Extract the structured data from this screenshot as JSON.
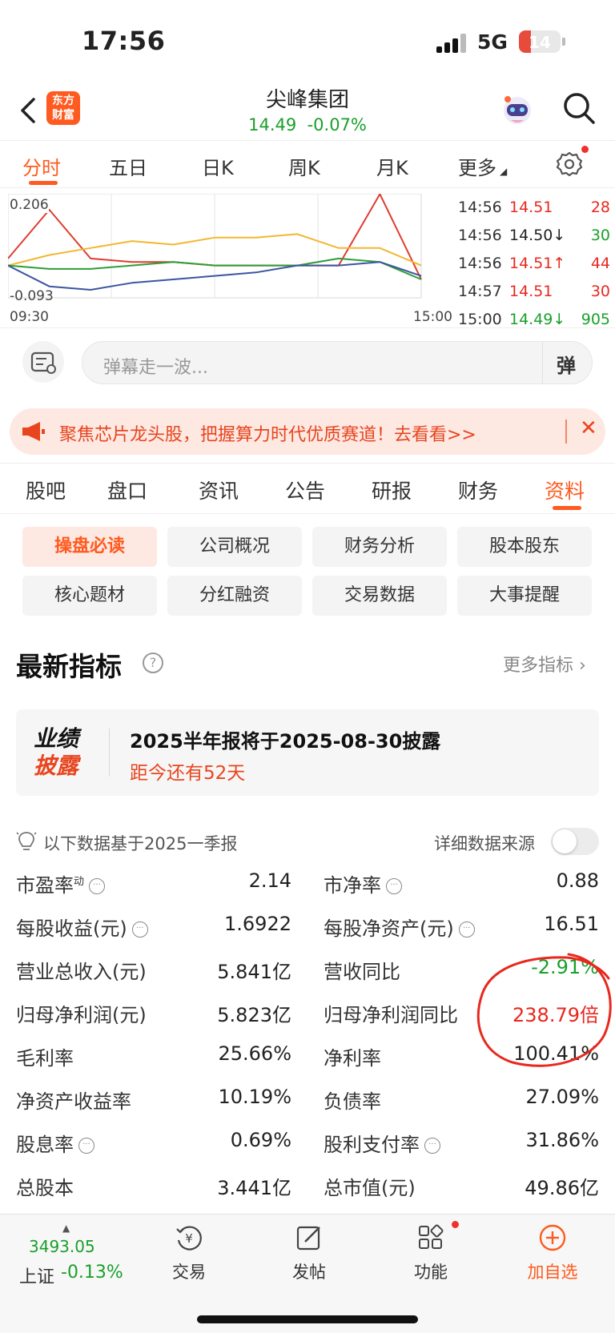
{
  "status_bar": {
    "time": "17:56",
    "network": "5G",
    "battery": "14"
  },
  "header": {
    "logo_line1": "东方",
    "logo_line2": "财富",
    "stock_name": "尖峰集团",
    "price": "14.49",
    "change": "-0.07%",
    "quote_color": "#19a02a"
  },
  "chart_tabs": [
    "分时",
    "五日",
    "日K",
    "周K",
    "月K",
    "更多"
  ],
  "chart": {
    "y_top": "0.206",
    "y_bottom": "-0.093",
    "x_start": "09:30",
    "x_end": "15:00"
  },
  "chart_data": {
    "type": "line",
    "x": [
      "09:30",
      "10:00",
      "10:30",
      "11:00",
      "11:30",
      "13:00",
      "13:30",
      "14:00",
      "14:30",
      "14:50",
      "15:00"
    ],
    "ylim": [
      -0.093,
      0.206
    ],
    "series": [
      {
        "color": "#e03b2f",
        "values": [
          0.02,
          0.16,
          0.02,
          0.01,
          0.01,
          0.0,
          0.0,
          0.0,
          0.0,
          0.205,
          -0.04
        ]
      },
      {
        "color": "#f2b730",
        "values": [
          0.0,
          0.03,
          0.05,
          0.07,
          0.06,
          0.08,
          0.08,
          0.09,
          0.05,
          0.05,
          0.0
        ]
      },
      {
        "color": "#2e9e37",
        "values": [
          0.0,
          -0.01,
          -0.01,
          0.0,
          0.01,
          0.0,
          0.0,
          0.0,
          0.02,
          0.01,
          -0.04
        ]
      },
      {
        "color": "#3b55a0",
        "values": [
          0.0,
          -0.06,
          -0.07,
          -0.05,
          -0.04,
          -0.03,
          -0.02,
          0.0,
          0.0,
          0.01,
          -0.03
        ]
      }
    ]
  },
  "ticks": [
    {
      "time": "14:56",
      "price": "14.51",
      "dir": "",
      "vol": "28",
      "pcolor": "#e8281e",
      "vcolor": "#e8281e"
    },
    {
      "time": "14:56",
      "price": "14.50",
      "dir": "↓",
      "vol": "30",
      "pcolor": "#222222",
      "vcolor": "#19a02a"
    },
    {
      "time": "14:56",
      "price": "14.51",
      "dir": "↑",
      "vol": "44",
      "pcolor": "#e8281e",
      "vcolor": "#e8281e"
    },
    {
      "time": "14:57",
      "price": "14.51",
      "dir": "",
      "vol": "30",
      "pcolor": "#e8281e",
      "vcolor": "#e8281e"
    },
    {
      "time": "15:00",
      "price": "14.49",
      "dir": "↓",
      "vol": "905",
      "pcolor": "#19a02a",
      "vcolor": "#19a02a"
    }
  ],
  "danmu": {
    "placeholder": "弹幕走一波...",
    "button": "弹"
  },
  "banner": {
    "text": "聚焦芯片龙头股，把握算力时代优质赛道！去看看>>",
    "close": "✕"
  },
  "main_tabs": [
    "股吧",
    "盘口",
    "资讯",
    "公告",
    "研报",
    "财务",
    "资料"
  ],
  "sub_tabs": [
    "操盘必读",
    "公司概况",
    "财务分析",
    "股本股东",
    "核心题材",
    "分红融资",
    "交易数据",
    "大事提醒"
  ],
  "section": {
    "title": "最新指标",
    "help": "?",
    "more": "更多指标 ›"
  },
  "disclosure": {
    "badge_top": "业绩",
    "badge_bottom": "披露",
    "line1": "2025半年报将于2025-08-30披露",
    "line2": "距今还有52天"
  },
  "basis": {
    "text": "以下数据基于2025一季报",
    "source_label": "详细数据来源"
  },
  "metrics": [
    {
      "l_label": "市盈率",
      "l_sup": "动",
      "l_info": true,
      "l_value": "2.14",
      "r_label": "市净率",
      "r_info": true,
      "r_value": "0.88",
      "r_color": ""
    },
    {
      "l_label": "每股收益(元)",
      "l_sup": "",
      "l_info": true,
      "l_value": "1.6922",
      "r_label": "每股净资产(元)",
      "r_info": true,
      "r_value": "16.51",
      "r_color": ""
    },
    {
      "l_label": "营业总收入(元)",
      "l_sup": "",
      "l_info": false,
      "l_value": "5.841亿",
      "r_label": "营收同比",
      "r_info": false,
      "r_value": "-2.91%",
      "r_color": "green"
    },
    {
      "l_label": "归母净利润(元)",
      "l_sup": "",
      "l_info": false,
      "l_value": "5.823亿",
      "r_label": "归母净利润同比",
      "r_info": false,
      "r_value": "238.79倍",
      "r_color": "red"
    },
    {
      "l_label": "毛利率",
      "l_sup": "",
      "l_info": false,
      "l_value": "25.66%",
      "r_label": "净利率",
      "r_info": false,
      "r_value": "100.41%",
      "r_color": ""
    },
    {
      "l_label": "净资产收益率",
      "l_sup": "",
      "l_info": false,
      "l_value": "10.19%",
      "r_label": "负债率",
      "r_info": false,
      "r_value": "27.09%",
      "r_color": ""
    },
    {
      "l_label": "股息率",
      "l_sup": "",
      "l_info": true,
      "l_value": "0.69%",
      "r_label": "股利支付率",
      "r_info": true,
      "r_value": "31.86%",
      "r_color": ""
    },
    {
      "l_label": "总股本",
      "l_sup": "",
      "l_info": false,
      "l_value": "3.441亿",
      "r_label": "总市值(元)",
      "r_info": false,
      "r_value": "49.86亿",
      "r_color": ""
    }
  ],
  "bottom_nav": {
    "index_value": "3493.05",
    "index_label": "上证",
    "index_change": "-0.13%",
    "items": [
      "交易",
      "发帖",
      "功能",
      "加自选"
    ]
  }
}
